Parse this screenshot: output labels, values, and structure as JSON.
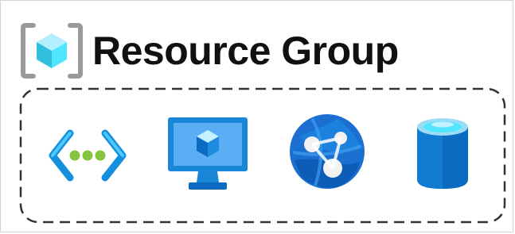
{
  "title": "Resource Group",
  "icons": {
    "resource_group": "resource-group-icon",
    "virtual_network": "virtual-network-icon",
    "virtual_machine": "virtual-machine-icon",
    "app_service": "app-service-icon",
    "sql_database": "sql-database-icon"
  },
  "colors": {
    "bracket_gray": "#9a9a9a",
    "azure_blue": "#0078d4",
    "light_blue": "#50e6ff",
    "green_dot": "#86c440",
    "dash_border": "#333333"
  }
}
